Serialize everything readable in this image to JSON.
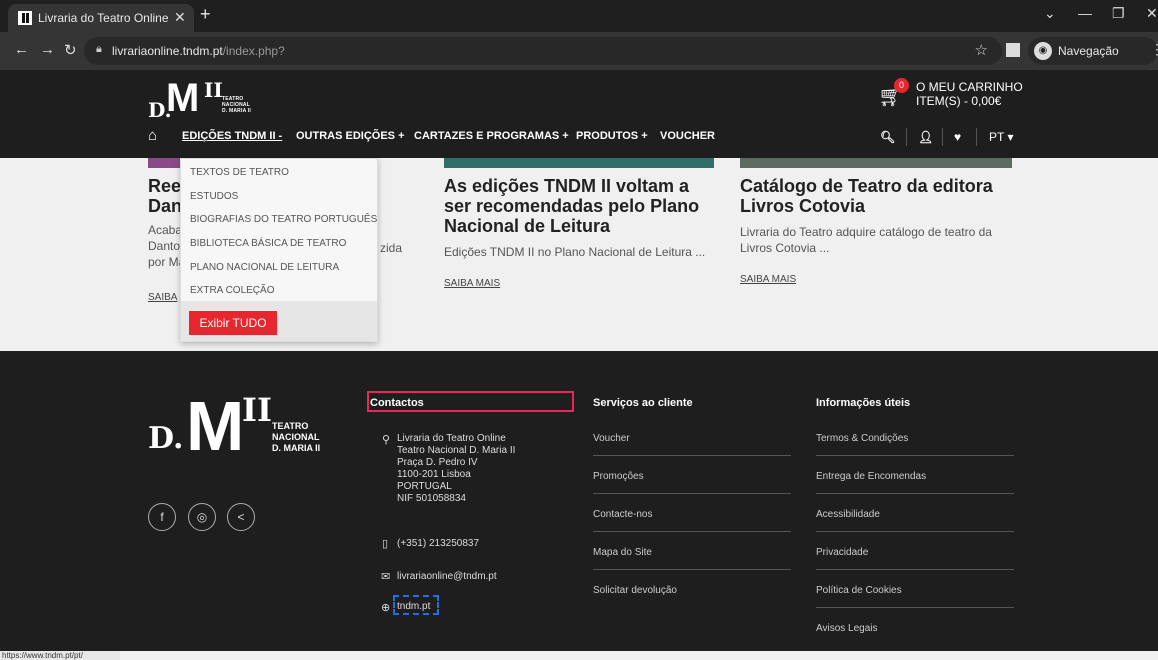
{
  "browser": {
    "tab_title": "Livraria do Teatro Online",
    "url_host": "livrariaonline.tndm.pt",
    "url_path": "/index.php?",
    "incognito_label": "Navegação anónima",
    "status_url": "https://www.tndm.pt/pt/"
  },
  "header": {
    "logo": {
      "d": "D.",
      "m": "M",
      "ii": "II",
      "lines": [
        "TEATRO",
        "NACIONAL",
        "D. MARIA II"
      ]
    },
    "cart": {
      "count": "0",
      "label": "O MEU CARRINHO",
      "summary": "ITEM(S) - 0,00€"
    },
    "nav": [
      {
        "label": "EDIÇÕES TNDM II -"
      },
      {
        "label": "OUTRAS EDIÇÕES +"
      },
      {
        "label": "CARTAZES E PROGRAMAS +"
      },
      {
        "label": "PRODUTOS +"
      },
      {
        "label": "VOUCHER"
      }
    ],
    "language": "PT"
  },
  "dropdown": {
    "items": [
      "TEXTOS DE TEATRO",
      "ESTUDOS",
      "BIOGRAFIAS DO TEATRO PORTUGUÊS",
      "BIBLIOTECA BÁSICA DE TEATRO",
      "PLANO NACIONAL DE LEITURA",
      "EXTRA COLEÇÃO"
    ],
    "button": "Exibir TUDO"
  },
  "cards": [
    {
      "title_lines": [
        "Ree",
        "Dan"
      ],
      "text_lines": [
        "Acaba",
        "Danto",
        "por Ma"
      ],
      "text_tail": "zida",
      "more": "SAIBA"
    },
    {
      "title_lines": [
        "As edições TNDM II voltam a",
        "ser recomendadas pelo Plano",
        "Nacional de Leitura"
      ],
      "text_lines": [
        "Edições TNDM II no Plano Nacional de Leitura ..."
      ],
      "more": "SAIBA MAIS"
    },
    {
      "title_lines": [
        "Catálogo de Teatro da editora",
        "Livros Cotovia"
      ],
      "text_lines": [
        " Livraria do Teatro adquire catálogo de teatro da",
        "Livros Cotovia ..."
      ],
      "more": "SAIBA MAIS"
    }
  ],
  "footer": {
    "logo": {
      "d": "D.",
      "m": "M",
      "ii": "II",
      "lines": [
        "TEATRO",
        "NACIONAL",
        "D. MARIA II"
      ]
    },
    "contacts": {
      "heading": "Contactos",
      "address": [
        "Livraria do Teatro Online",
        "Teatro Nacional D. Maria II",
        "Praça D. Pedro IV",
        "1100-201 Lisboa",
        "PORTUGAL",
        "NIF 501058834"
      ],
      "phone": "(+351) 213250837",
      "email": "livrariaonline@tndm.pt",
      "website": "tndm.pt"
    },
    "services": {
      "heading": "Serviços ao cliente",
      "links": [
        "Voucher",
        "Promoções",
        "Contacte-nos",
        "Mapa do Site",
        "Solicitar devolução"
      ]
    },
    "info": {
      "heading": "Informações úteis",
      "links": [
        "Termos & Condições",
        "Entrega de Encomendas",
        "Acessibilidade",
        "Privacidade",
        "Política de Cookies",
        "Avisos Legais"
      ]
    }
  }
}
